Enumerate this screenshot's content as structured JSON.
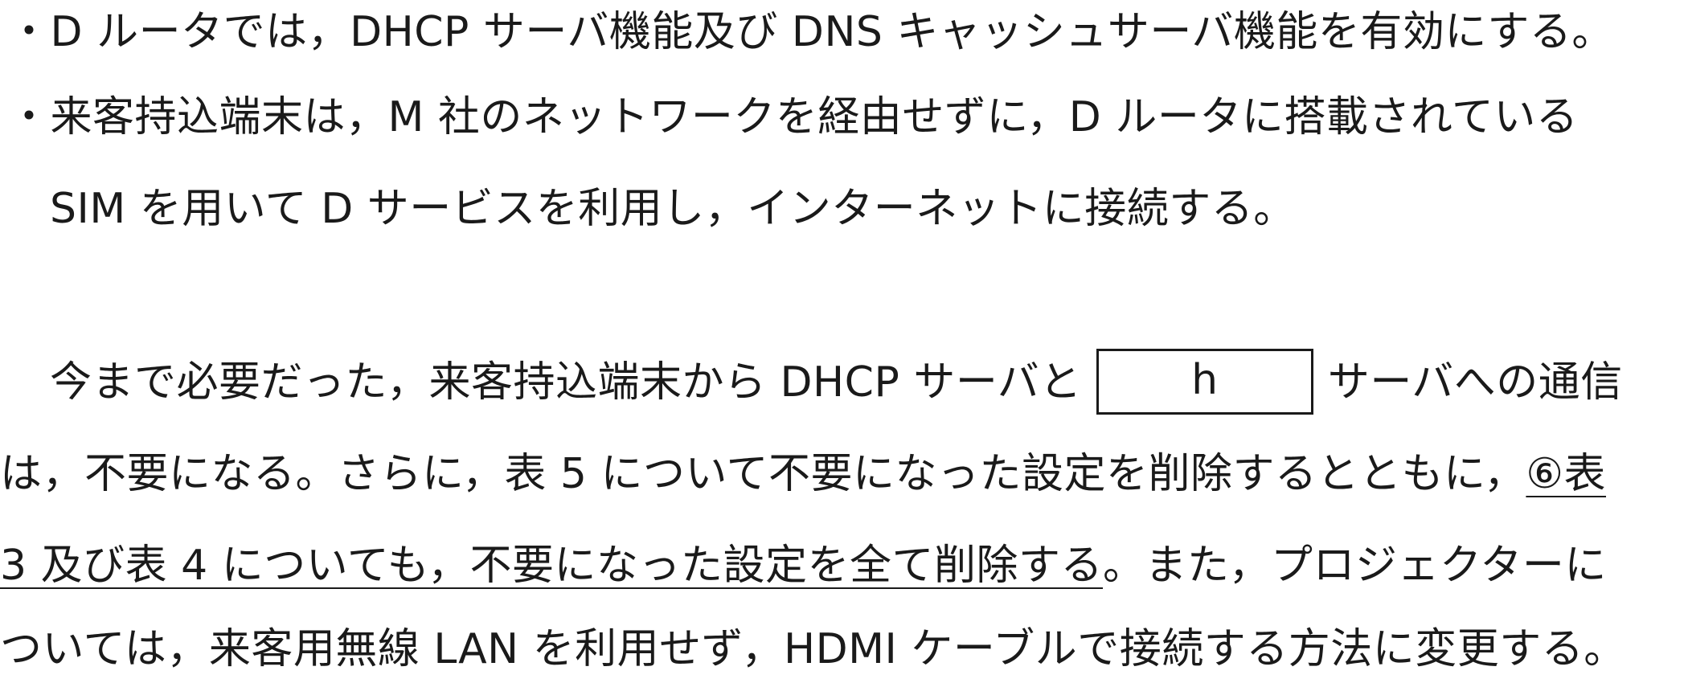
{
  "bullets": [
    {
      "mark": "・",
      "text": "D ルータでは，DHCP サーバ機能及び DNS キャッシュサーバ機能を有効にする。"
    },
    {
      "mark": "・",
      "text": "来客持込端末は，M 社のネットワークを経由せずに，D ルータに搭載されている"
    }
  ],
  "bullet2_continuation": "SIM を用いて D サービスを利用し，インターネットに接続する。",
  "paragraph": {
    "line1_before_blank": "今まで必要だった，来客持込端末から DHCP サーバと",
    "blank_label": "h",
    "line1_after_blank": "サーバへの通信",
    "line2_before_underline": "は，不要になる。さらに，表 5 について不要になった設定を削除するとともに，",
    "line2_underlined": "⑥表",
    "line3_underlined": "3 及び表 4 についても，不要になった設定を全て削除する",
    "line3_after_underline": "。また，プロジェクターに",
    "line4": "ついては，来客用無線 LAN を利用せず，HDMI ケーブルで接続する方法に変更する。"
  }
}
